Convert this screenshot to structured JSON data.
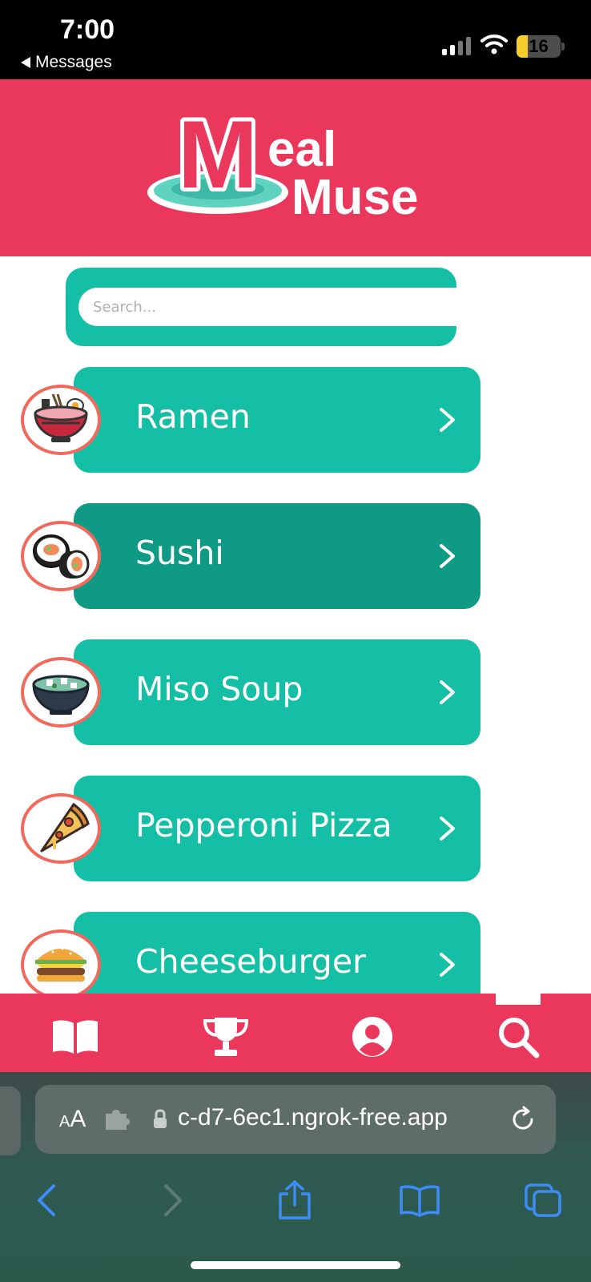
{
  "status_bar": {
    "time": "7:00",
    "back_label": "Messages",
    "battery_level": "16",
    "battery_fraction": 0.25
  },
  "header": {
    "logo_letter": "M",
    "logo_word_1": "eal",
    "logo_word_2": "Muse",
    "colors": {
      "brand_red": "#ea385d",
      "teal": "#14bfa6",
      "plate": "#5fd3c0"
    }
  },
  "search": {
    "placeholder": "Search...",
    "value": ""
  },
  "food_list": {
    "items": [
      {
        "label": "Ramen",
        "icon": "ramen-bowl-icon",
        "selected": false
      },
      {
        "label": "Sushi",
        "icon": "sushi-roll-icon",
        "selected": true
      },
      {
        "label": "Miso Soup",
        "icon": "miso-soup-icon",
        "selected": false
      },
      {
        "label": "Pepperoni Pizza",
        "icon": "pizza-slice-icon",
        "selected": false
      },
      {
        "label": "Cheeseburger",
        "icon": "cheeseburger-icon",
        "selected": false
      }
    ],
    "colors": {
      "card": "#14bfa6",
      "card_selected": "#0f9a86",
      "avatar_ring": "#f0695c"
    }
  },
  "bottom_nav": {
    "items": [
      {
        "icon": "book-icon",
        "active": false
      },
      {
        "icon": "trophy-icon",
        "active": false
      },
      {
        "icon": "user-icon",
        "active": false
      },
      {
        "icon": "search-icon",
        "active": true
      }
    ]
  },
  "browser": {
    "aa_label": "AA",
    "url": "c-d7-6ec1.ngrok-free.app",
    "tools": [
      "back-arrow-icon",
      "forward-arrow-icon",
      "share-icon",
      "bookmarks-icon",
      "tabs-icon"
    ]
  }
}
